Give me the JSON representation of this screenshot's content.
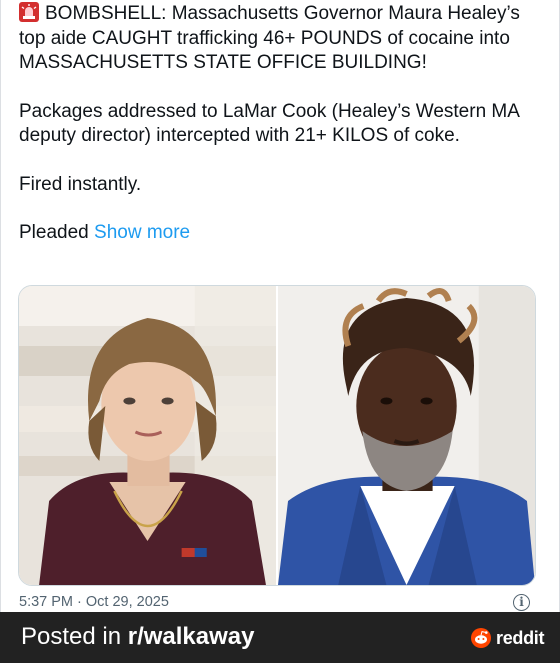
{
  "post": {
    "siren_icon": "police-siren-emoji",
    "headline": "BOMBSHELL: Massachusetts Governor Maura Healey’s top aide CAUGHT trafficking 46+ POUNDS of cocaine into MASSACHUSETTS STATE OFFICE BUILDING!",
    "paragraph2": "Packages addressed to LaMar Cook (Healey’s Western MA deputy director) intercepted with 21+ KILOS of coke.",
    "paragraph3": "Fired instantly.",
    "paragraph4_prefix": "Pleaded ",
    "show_more": "Show more",
    "timestamp": "5:37 PM · Oct 29, 2025",
    "info_icon": "i",
    "link_color": "#1d9bf0"
  },
  "media": {
    "left_photo": "woman-portrait",
    "right_photo": "man-portrait"
  },
  "footer": {
    "posted_prefix": "Posted in ",
    "subreddit": "r/walkaway",
    "brand": "reddit",
    "brand_icon": "reddit-snoo-icon",
    "brand_color": "#ff4500"
  }
}
